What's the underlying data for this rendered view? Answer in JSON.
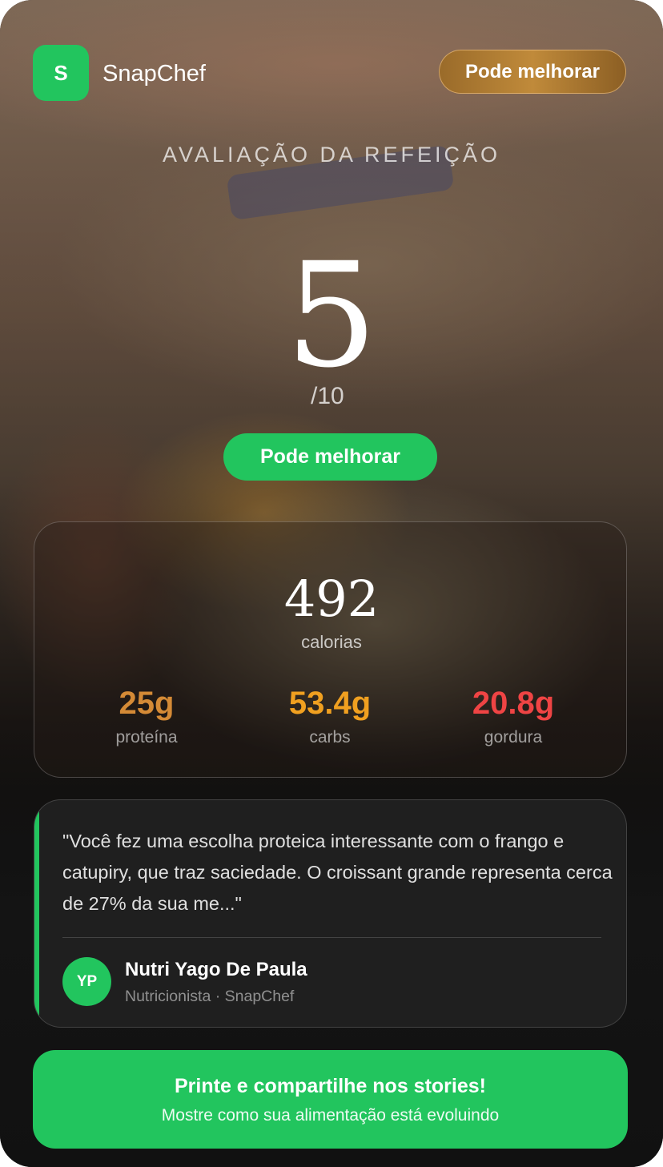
{
  "header": {
    "logo_letter": "S",
    "brand": "SnapChef",
    "badge": "Pode melhorar"
  },
  "rating": {
    "eyebrow": "AVALIAÇÃO DA REFEIÇÃO",
    "score": "5",
    "denominator": "/10",
    "badge": "Pode melhorar"
  },
  "nutrition": {
    "calories_value": "492",
    "calories_label": "calorias",
    "macros": [
      {
        "value": "25g",
        "label": "proteína",
        "color": "#d48a36"
      },
      {
        "value": "53.4g",
        "label": "carbs",
        "color": "#f0a020"
      },
      {
        "value": "20.8g",
        "label": "gordura",
        "color": "#ef4444"
      }
    ]
  },
  "quote": {
    "text": "\"Você fez uma escolha proteica interessante com o frango e catupiry, que traz saciedade. O croissant grande representa cerca de 27% da sua me...\"",
    "author_initials": "YP",
    "author_name": "Nutri Yago De Paula",
    "author_role": "Nutricionista · SnapChef"
  },
  "cta": {
    "title": "Printe e compartilhe nos stories!",
    "subtitle": "Mostre como sua alimentação está evoluindo"
  },
  "colors": {
    "accent": "#22c55e",
    "badge_gold": "#b07c32"
  }
}
